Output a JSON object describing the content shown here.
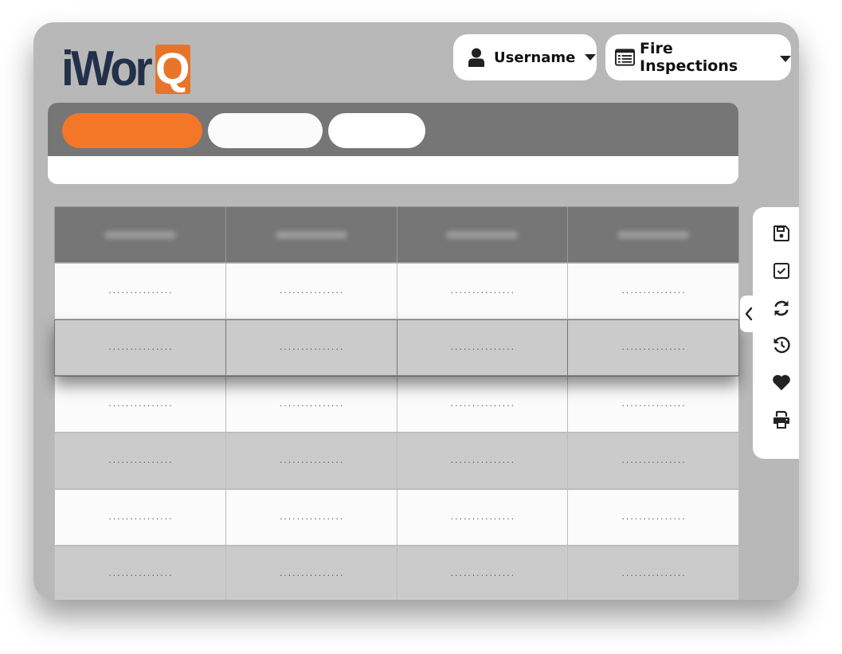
{
  "brand": {
    "logo_main": "iWor",
    "logo_accent": "Q",
    "accent_color": "#f47727",
    "logo_color": "#233049"
  },
  "header": {
    "user_menu": {
      "label": "Username",
      "icon": "user-icon"
    },
    "module_menu": {
      "label": "Fire Inspections",
      "icon": "list-icon"
    }
  },
  "tabs": [
    {
      "label": "",
      "active": true
    },
    {
      "label": "",
      "active": false
    },
    {
      "label": "",
      "active": false
    }
  ],
  "table": {
    "headers": [
      "",
      "",
      "",
      ""
    ],
    "rows": [
      {
        "style": "white",
        "cells": [
          "...............",
          "...............",
          "...............",
          "..............."
        ]
      },
      {
        "style": "gray",
        "elevated": true,
        "cells": [
          "...............",
          "...............",
          "...............",
          "..............."
        ]
      },
      {
        "style": "white",
        "cells": [
          "...............",
          "...............",
          "...............",
          "..............."
        ]
      },
      {
        "style": "gray",
        "cells": [
          "...............",
          "...............",
          "...............",
          "..............."
        ]
      },
      {
        "style": "white",
        "cells": [
          "...............",
          "...............",
          "...............",
          "..............."
        ]
      },
      {
        "style": "gray",
        "cells": [
          "...............",
          "...............",
          "...............",
          "..............."
        ]
      }
    ]
  },
  "toolbar": {
    "items": [
      {
        "name": "save",
        "icon": "floppy-disk-icon"
      },
      {
        "name": "complete",
        "icon": "checkbox-icon"
      },
      {
        "name": "refresh",
        "icon": "refresh-icon"
      },
      {
        "name": "history",
        "icon": "history-icon"
      },
      {
        "name": "favorite",
        "icon": "heart-icon"
      },
      {
        "name": "print",
        "icon": "printer-icon"
      }
    ],
    "collapse_icon": "chevron-left-icon"
  }
}
